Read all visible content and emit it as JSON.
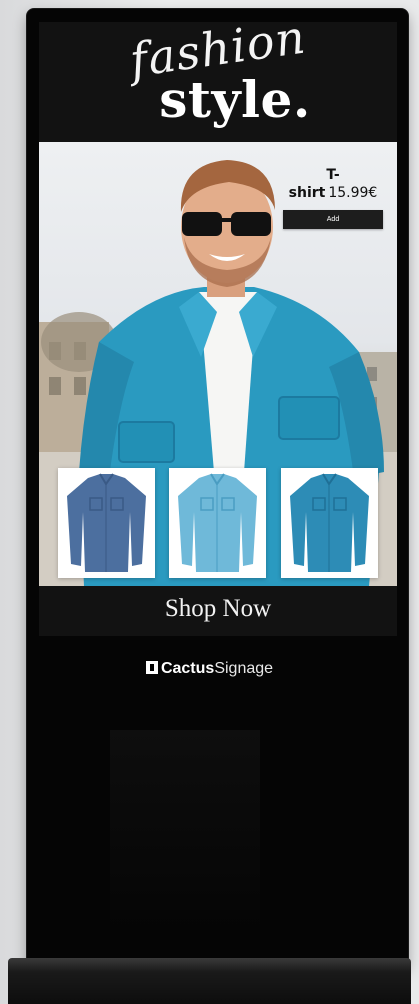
{
  "brand": {
    "script_text": "fashion",
    "main_text": "style."
  },
  "product": {
    "name": "T-shirt",
    "price": "15.99€",
    "add_label": "Add"
  },
  "thumbnails": [
    {
      "label": "dark-denim-shirt",
      "color": "#4c6f9f"
    },
    {
      "label": "light-denim-shirt",
      "color": "#6fb9d9"
    },
    {
      "label": "teal-denim-shirt",
      "color": "#2d8cb6"
    }
  ],
  "cta": {
    "label": "Shop Now"
  },
  "logo": {
    "bold_text": "Cactus",
    "thin_text": "Signage"
  },
  "colors": {
    "frame": "#050505",
    "screen_band": "#121212",
    "denim": "#2a9ac0",
    "button": "#1d1d1d"
  }
}
